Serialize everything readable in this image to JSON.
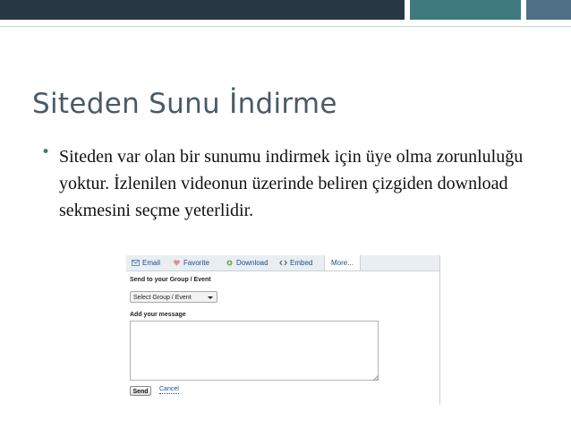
{
  "slide": {
    "title": "Siteden Sunu İndirme",
    "bullet": "Siteden var olan bir sunumu indirmek için üye olma zorunluluğu yoktur. İzlenilen videonun üzerinde beliren çizgiden download sekmesini seçme yeterlidir."
  },
  "colors": {
    "band_dark": "#283744",
    "band_teal": "#3f7a7f",
    "band_slate": "#4e6f86",
    "title": "#4a5a66"
  },
  "share_panel": {
    "tabs": [
      {
        "label": "Email",
        "icon": "envelope-icon"
      },
      {
        "label": "Favorite",
        "icon": "heart-icon"
      },
      {
        "label": "Download",
        "icon": "download-icon"
      },
      {
        "label": "Embed",
        "icon": "code-icon"
      },
      {
        "label": "More...",
        "icon": ""
      }
    ],
    "send_to_label": "Send to your Group / Event",
    "group_select_value": "Select Group / Event",
    "message_label": "Add your message",
    "message_value": "",
    "send_button": "Send",
    "cancel_link": "Cancel"
  }
}
